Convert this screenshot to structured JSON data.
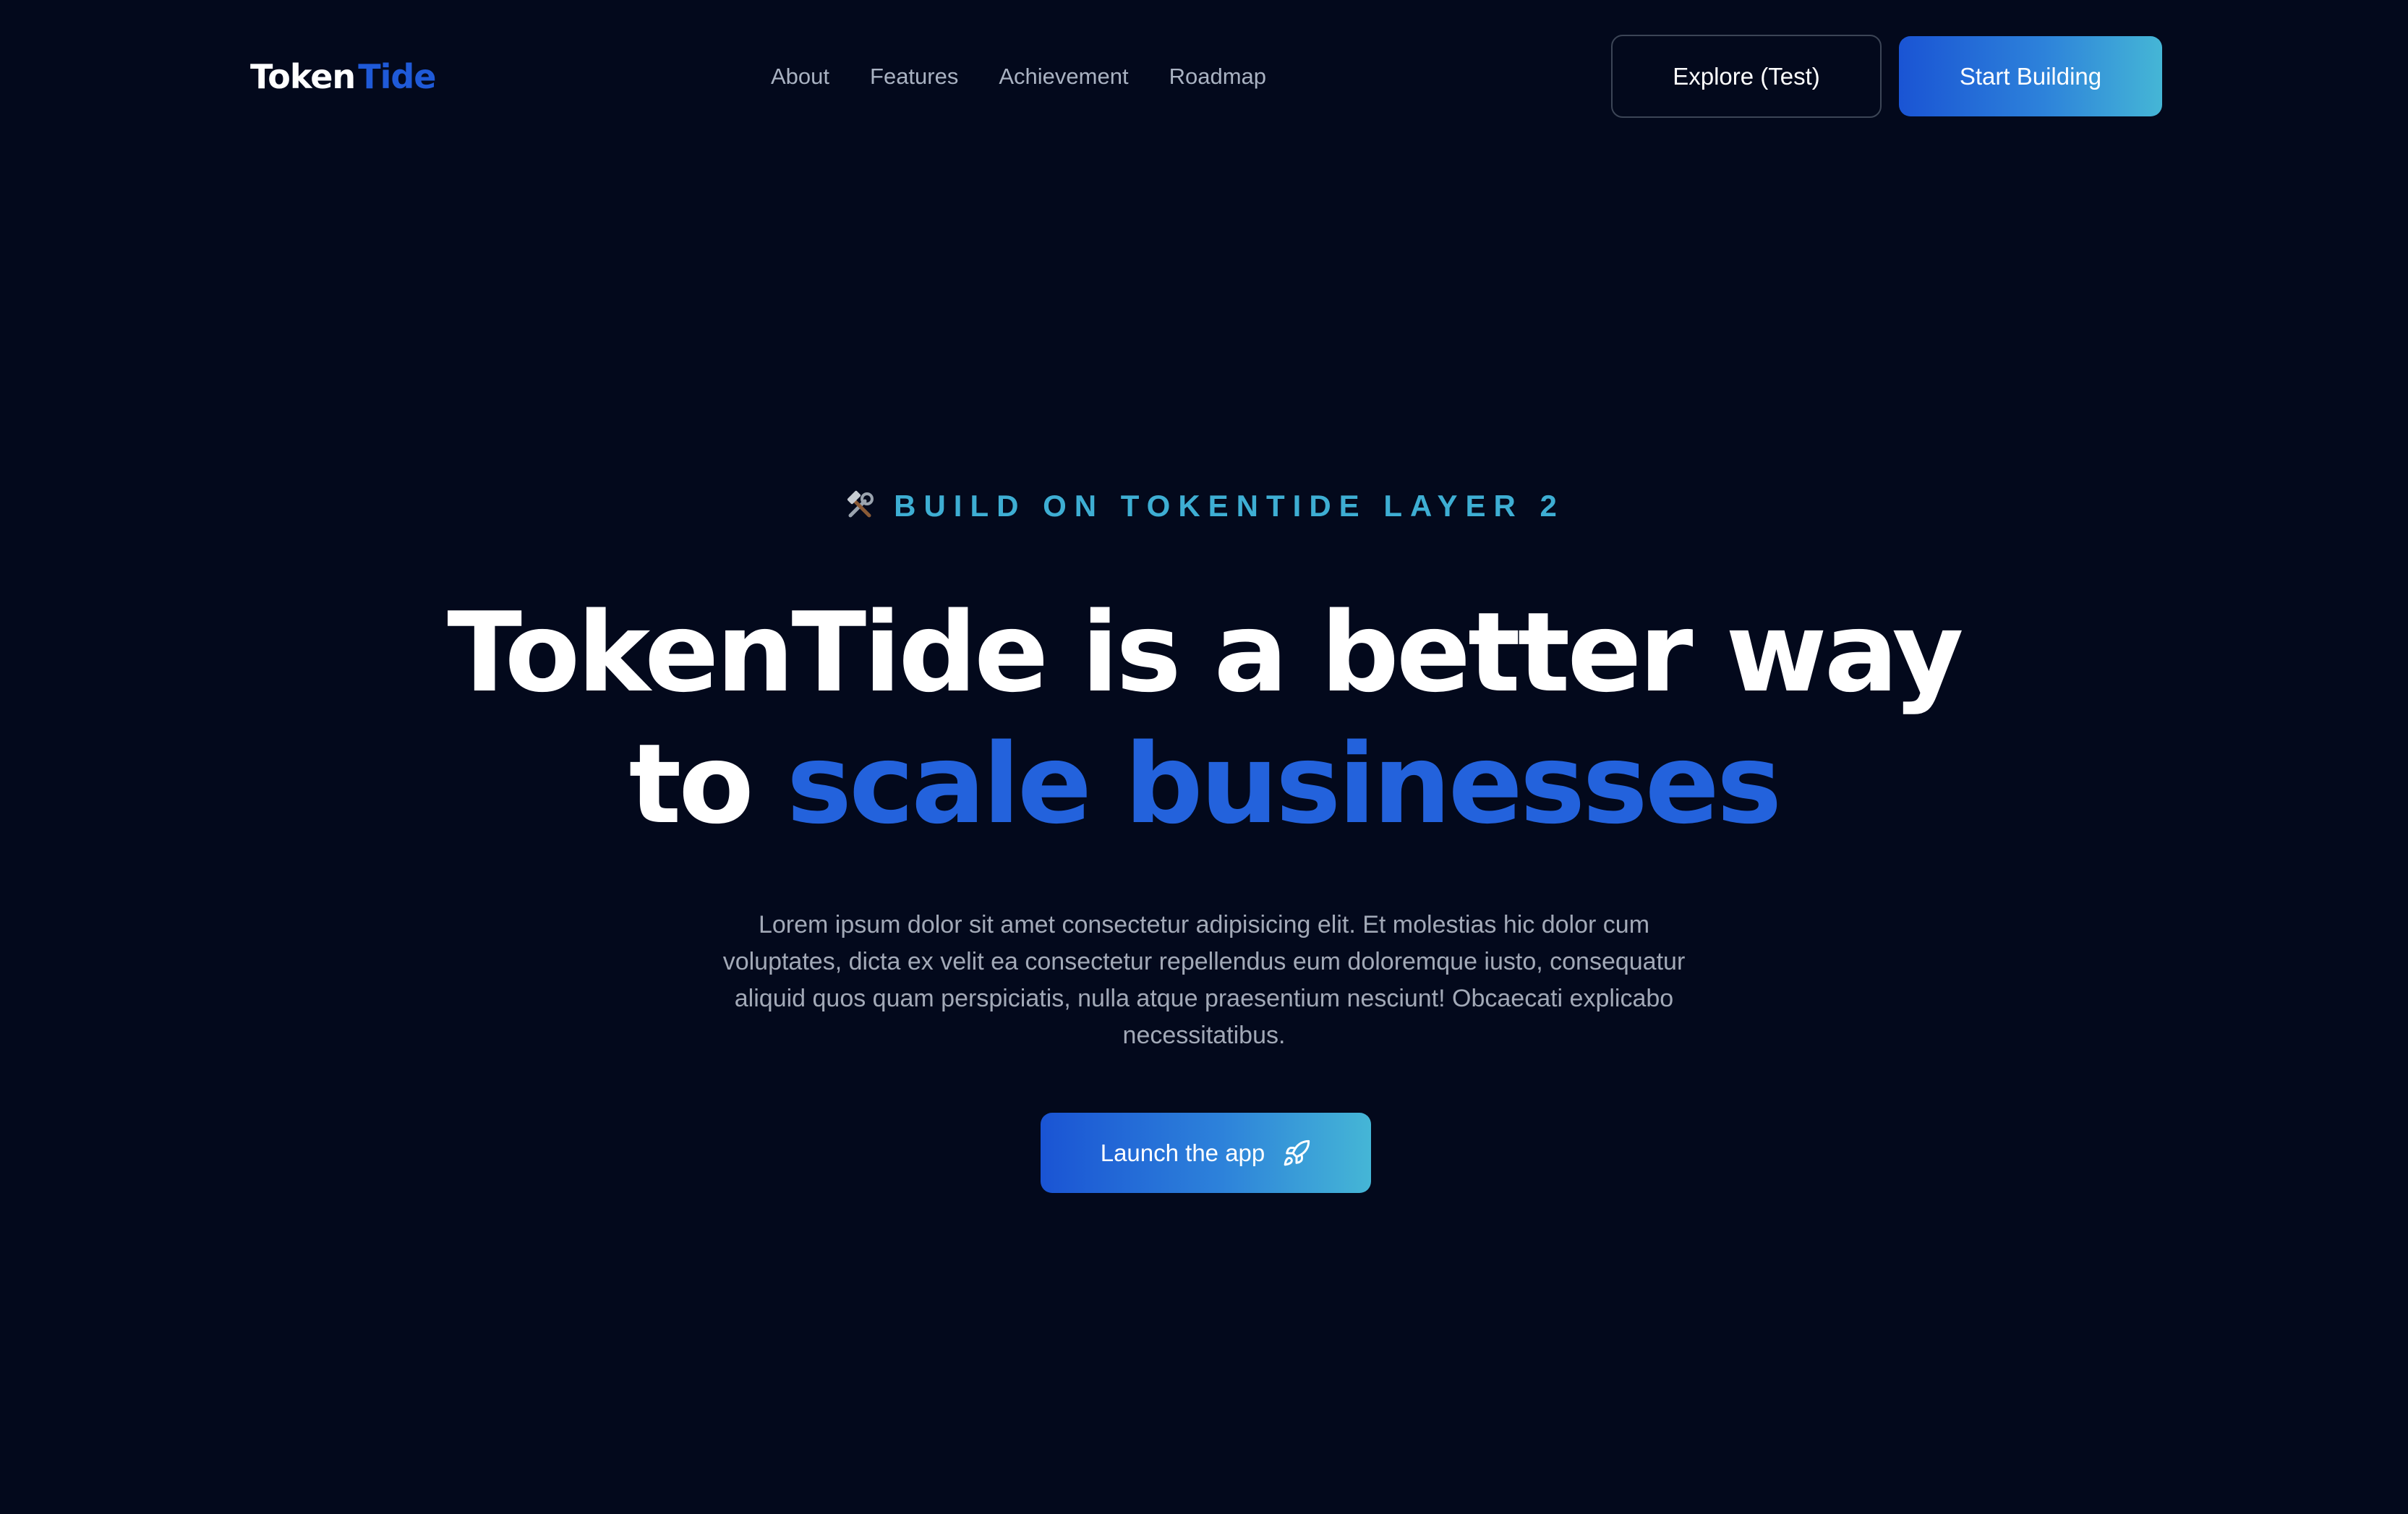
{
  "brand": {
    "name_part1": "Token",
    "name_part2": "Tide",
    "accent_color": "#1f5ad8"
  },
  "nav": {
    "items": [
      {
        "label": "About"
      },
      {
        "label": "Features"
      },
      {
        "label": "Achievement"
      },
      {
        "label": "Roadmap"
      }
    ]
  },
  "header": {
    "explore_label": "Explore (Test)",
    "start_label": "Start Building"
  },
  "hero": {
    "eyebrow_icon": "hammer-and-wrench-icon",
    "eyebrow": "BUILD ON TOKENTIDE LAYER 2",
    "headline_line1": "TokenTide is a better way",
    "headline_line2_prefix": "to ",
    "headline_line2_accent": "scale businesses",
    "description": "Lorem ipsum dolor sit amet consectetur adipisicing elit. Et molestias hic dolor cum voluptates, dicta ex velit ea consectetur repellendus eum doloremque iusto, consequatur aliquid quos quam perspiciatis, nulla atque praesentium nesciunt! Obcaecati explicabo necessitatibus.",
    "cta_label": "Launch the app",
    "cta_icon": "rocket-icon"
  },
  "colors": {
    "background": "#03091c",
    "accent_blue": "#2362dc",
    "eyebrow_teal": "#3eaed3",
    "gradient_start": "#1a54d4",
    "gradient_end": "#45b6d6"
  }
}
